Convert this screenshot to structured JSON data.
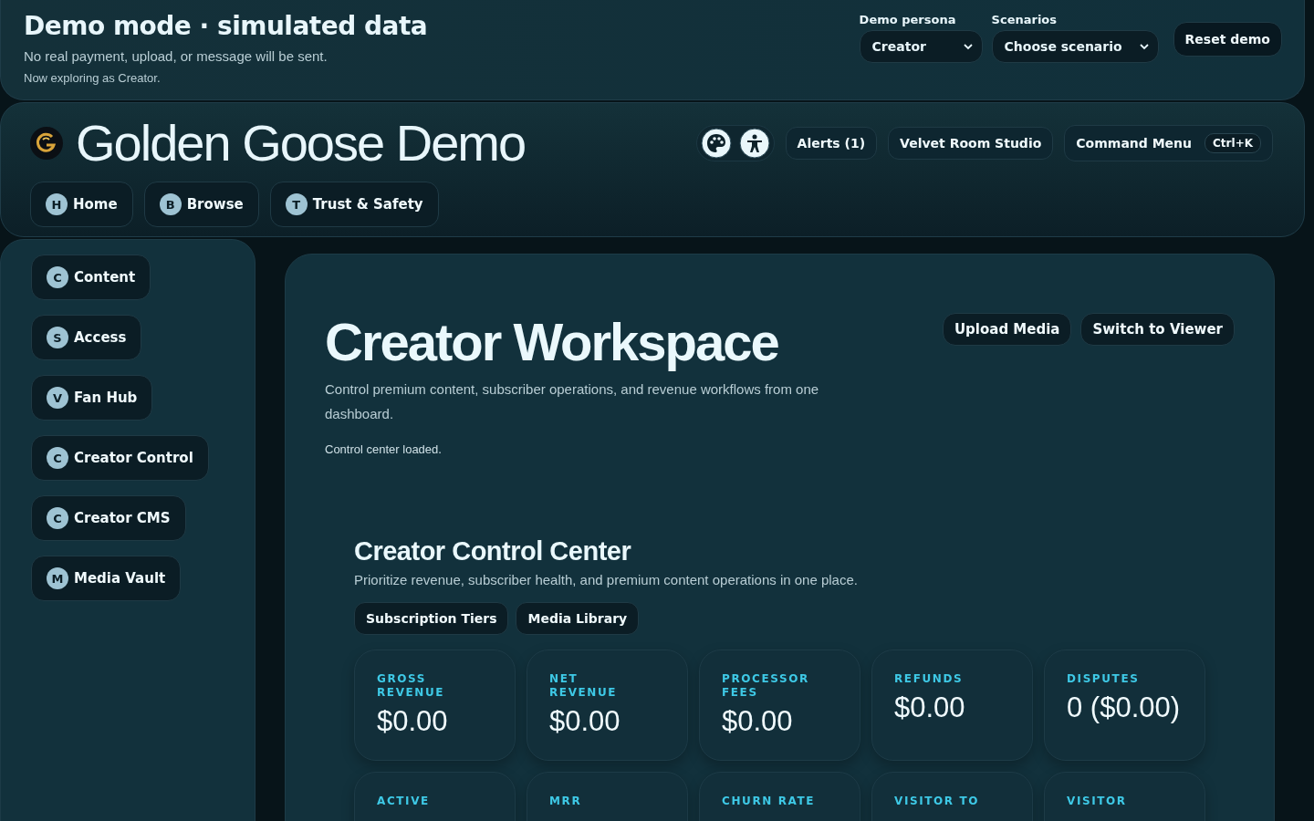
{
  "demo_banner": {
    "title": "Demo mode · simulated data",
    "subtitle": "No real payment, upload, or message will be sent.",
    "persona_note": "Now exploring as Creator.",
    "selects": [
      {
        "label": "Demo persona",
        "value": "Creator"
      },
      {
        "label": "Scenarios",
        "value": "Choose scenario"
      }
    ],
    "reset_button": "Reset demo"
  },
  "header": {
    "brand": "Golden Goose Demo",
    "icon_buttons": [
      {
        "kind": "palette"
      },
      {
        "kind": "accessibility"
      }
    ],
    "buttons": [
      "Alerts (1)",
      "Velvet Room Studio"
    ],
    "command_menu": {
      "label": "Command Menu",
      "shortcut": "Ctrl+K"
    },
    "nav": [
      {
        "badge": "H",
        "label": "Home"
      },
      {
        "badge": "B",
        "label": "Browse"
      },
      {
        "badge": "T",
        "label": "Trust & Safety"
      }
    ]
  },
  "sidebar": {
    "items": [
      {
        "badge": "C",
        "label": "Content"
      },
      {
        "badge": "S",
        "label": "Access"
      },
      {
        "badge": "V",
        "label": "Fan Hub"
      },
      {
        "badge": "C",
        "label": "Creator Control"
      },
      {
        "badge": "C",
        "label": "Creator CMS"
      },
      {
        "badge": "M",
        "label": "Media Vault"
      }
    ]
  },
  "workspace": {
    "title": "Creator Workspace",
    "description": "Control premium content, subscriber operations, and revenue workflows from one dashboard.",
    "status": "Control center loaded.",
    "actions": [
      "Upload Media",
      "Switch to Viewer"
    ],
    "control_center": {
      "title": "Creator Control Center",
      "description": "Prioritize revenue, subscriber health, and premium content operations in one place.",
      "tabs": [
        "Subscription Tiers",
        "Media Library"
      ],
      "metrics": [
        {
          "label": "GROSS REVENUE",
          "value": "$0.00"
        },
        {
          "label": "NET REVENUE",
          "value": "$0.00"
        },
        {
          "label": "PROCESSOR FEES",
          "value": "$0.00"
        },
        {
          "label": "REFUNDS",
          "value": "$0.00"
        },
        {
          "label": "DISPUTES",
          "value": "0 ($0.00)"
        },
        {
          "label": "ACTIVE"
        },
        {
          "label": "MRR"
        },
        {
          "label": "CHURN RATE"
        },
        {
          "label": "VISITOR TO"
        },
        {
          "label": "VISITOR"
        }
      ]
    }
  }
}
